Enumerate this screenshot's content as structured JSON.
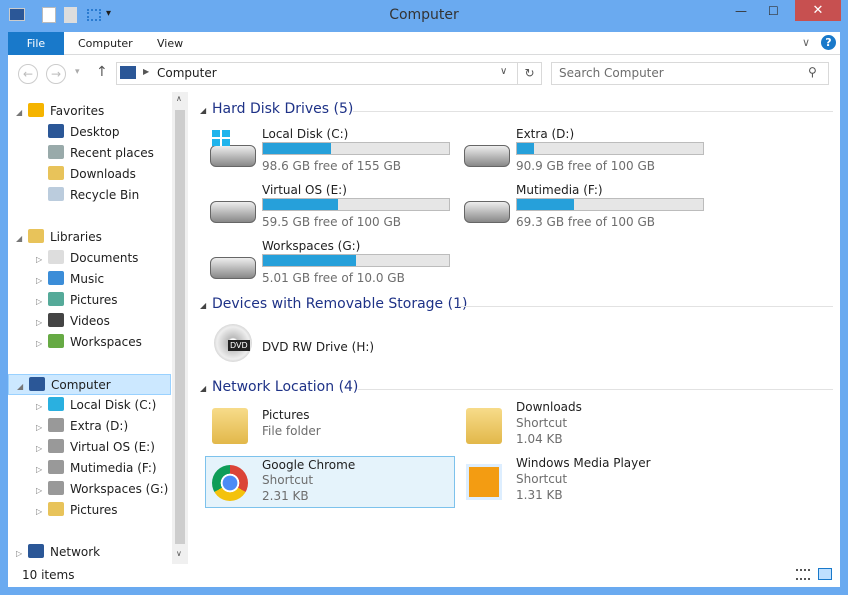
{
  "window": {
    "title": "Computer",
    "close": "✕"
  },
  "ribbon": {
    "tabs": [
      "File",
      "Computer",
      "View"
    ],
    "help": "?"
  },
  "address": {
    "path": "Computer",
    "search_placeholder": "Search Computer"
  },
  "nav": {
    "items": [
      {
        "label": "Favorites",
        "level": 0,
        "icon": "star-icon",
        "color": "#f5b400"
      },
      {
        "label": "Desktop",
        "level": 1,
        "icon": "desktop-icon",
        "color": "#2b5797"
      },
      {
        "label": "Recent places",
        "level": 1,
        "icon": "recent-places-icon",
        "color": "#9aa"
      },
      {
        "label": "Downloads",
        "level": 1,
        "icon": "downloads-icon",
        "color": "#e8c35a"
      },
      {
        "label": "Recycle Bin",
        "level": 1,
        "icon": "recycle-bin-icon",
        "color": "#bcd"
      },
      {
        "label": "Libraries",
        "level": 0,
        "icon": "libraries-icon",
        "color": "#e8c35a"
      },
      {
        "label": "Documents",
        "level": 1,
        "icon": "documents-icon",
        "color": "#ddd"
      },
      {
        "label": "Music",
        "level": 1,
        "icon": "music-icon",
        "color": "#3b8dd8"
      },
      {
        "label": "Pictures",
        "level": 1,
        "icon": "pictures-icon",
        "color": "#5a9"
      },
      {
        "label": "Videos",
        "level": 1,
        "icon": "videos-icon",
        "color": "#444"
      },
      {
        "label": "Workspaces",
        "level": 1,
        "icon": "workspaces-icon",
        "color": "#6a4"
      },
      {
        "label": "Computer",
        "level": 0,
        "icon": "computer-icon",
        "color": "#2b5797",
        "selected": true
      },
      {
        "label": "Local Disk (C:)",
        "level": 1,
        "icon": "drive-icon",
        "color": "#2ab0e0"
      },
      {
        "label": "Extra (D:)",
        "level": 1,
        "icon": "drive-icon",
        "color": "#999"
      },
      {
        "label": "Virtual OS (E:)",
        "level": 1,
        "icon": "drive-icon",
        "color": "#999"
      },
      {
        "label": "Mutimedia (F:)",
        "level": 1,
        "icon": "drive-icon",
        "color": "#999"
      },
      {
        "label": "Workspaces (G:)",
        "level": 1,
        "icon": "drive-icon",
        "color": "#999"
      },
      {
        "label": "Pictures",
        "level": 1,
        "icon": "folder-icon",
        "color": "#e8c35a"
      },
      {
        "label": "Network",
        "level": 0,
        "icon": "network-icon",
        "color": "#2b5797"
      }
    ]
  },
  "groups": {
    "hdd": "Hard Disk Drives (5)",
    "removable": "Devices with Removable Storage (1)",
    "network": "Network Location (4)"
  },
  "drives": [
    {
      "name": "Local Disk (C:)",
      "free": "98.6 GB free of 155 GB",
      "used_fraction": 0.364
    },
    {
      "name": "Extra (D:)",
      "free": "90.9 GB free of 100 GB",
      "used_fraction": 0.091
    },
    {
      "name": "Virtual OS (E:)",
      "free": "59.5 GB free of 100 GB",
      "used_fraction": 0.405
    },
    {
      "name": "Mutimedia (F:)",
      "free": "69.3 GB free of 100 GB",
      "used_fraction": 0.307
    },
    {
      "name": "Workspaces (G:)",
      "free": "5.01 GB free of 10.0 GB",
      "used_fraction": 0.499
    }
  ],
  "removable": {
    "name": "DVD RW Drive (H:)",
    "badge": "DVD"
  },
  "network": [
    {
      "name": "Pictures",
      "type": "File folder",
      "size": ""
    },
    {
      "name": "Downloads",
      "type": "Shortcut",
      "size": "1.04 KB"
    },
    {
      "name": "Google Chrome",
      "type": "Shortcut",
      "size": "2.31 KB"
    },
    {
      "name": "Windows Media Player",
      "type": "Shortcut",
      "size": "1.31 KB"
    }
  ],
  "status": {
    "count": "10 items"
  },
  "colors": {
    "accent": "#1979ca",
    "bar": "#26a0da",
    "titlebar": "#6aaaf0"
  }
}
